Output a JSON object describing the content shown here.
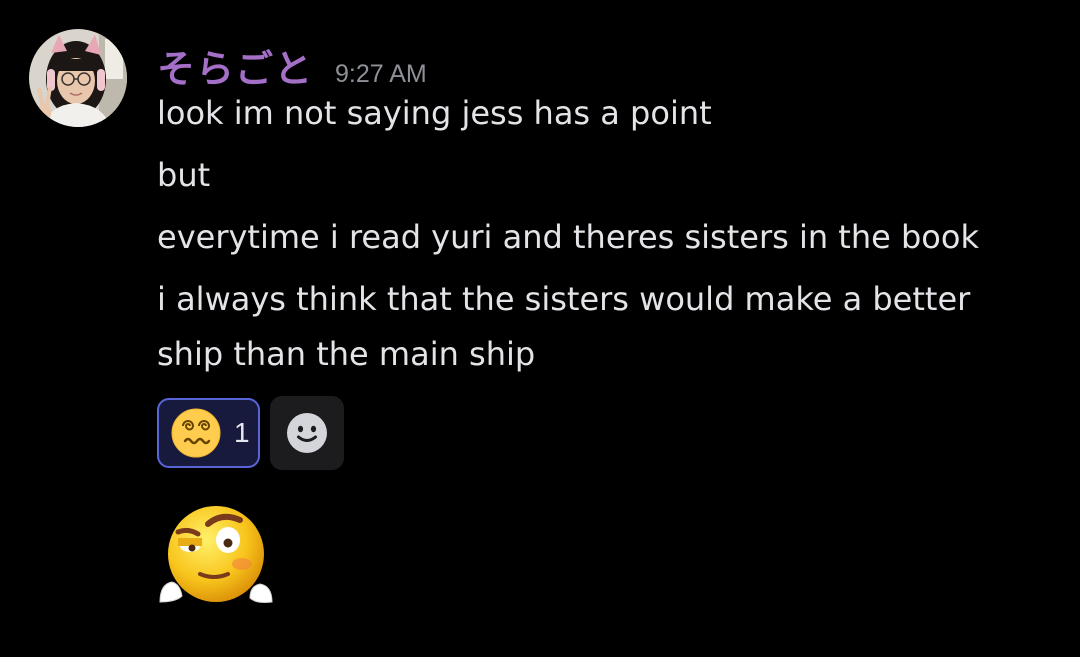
{
  "message": {
    "username": "そらごと",
    "timestamp": "9:27 AM",
    "lines": [
      "look im not saying jess has a point",
      "but",
      "everytime i read yuri and theres sisters in the book",
      "i always think that the sisters would make a better",
      "ship than the main ship"
    ],
    "reactions": [
      {
        "icon": "dizzy-face-icon",
        "count": "1"
      }
    ],
    "add_reaction_icon": "smiley-face-icon",
    "sticker_icon": "eyebrow-raised-emoji-sticker"
  },
  "colors": {
    "background": "#000000",
    "username": "#a36fc7",
    "timestamp": "#8e9098",
    "text": "#e4e4e8",
    "reaction_border": "#5865d6",
    "reaction_bg": "#181a3d",
    "add_reaction_bg": "#1c1c1f"
  }
}
